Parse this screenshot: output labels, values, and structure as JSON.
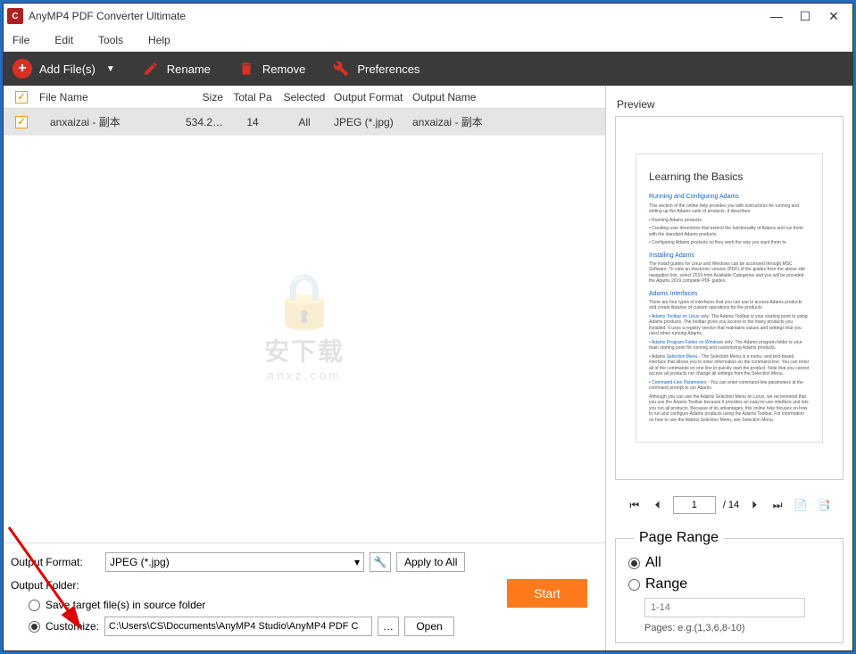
{
  "app": {
    "title": "AnyMP4 PDF Converter Ultimate"
  },
  "menubar": {
    "file": "File",
    "edit": "Edit",
    "tools": "Tools",
    "help": "Help"
  },
  "toolbar": {
    "add_files": "Add File(s)",
    "rename": "Rename",
    "remove": "Remove",
    "preferences": "Preferences"
  },
  "table": {
    "headers": {
      "file_name": "File Name",
      "size": "Size",
      "total_pa": "Total Pa",
      "selected": "Selected",
      "output_format": "Output Format",
      "output_name": "Output Name"
    },
    "rows": [
      {
        "checked": true,
        "file_name": "anxaizai - 副本",
        "size": "534.2…",
        "total_pages": "14",
        "selected": "All",
        "output_format": "JPEG (*.jpg)",
        "output_name": "anxaizai - 副本"
      }
    ]
  },
  "watermark": {
    "text": "安下载",
    "url": "anxz.com"
  },
  "bottom": {
    "output_format_label": "Output Format:",
    "format_value": "JPEG (*.jpg)",
    "apply_all": "Apply to All",
    "output_folder_label": "Output Folder:",
    "save_source": "Save target file(s) in source folder",
    "customize": "Customize:",
    "path": "C:\\Users\\CS\\Documents\\AnyMP4 Studio\\AnyMP4 PDF C",
    "browse": "…",
    "open": "Open",
    "start": "Start"
  },
  "preview": {
    "label": "Preview",
    "doc_title": "Learning the Basics",
    "h_running": "Running and Configuring Adams",
    "p1": "This section of the online help provides you with instructions for running and setting up the Adams suite of products. It describes:",
    "b1": "Running Adams products",
    "b2": "Creating user directories that extend the functionality of Adams and run them with the standard Adams products.",
    "b3": "Configuring Adams products so they work the way you want them to.",
    "h_install": "Installing Adams",
    "p2": "The install guides for Linux and Windows can be accessed through MSC Software. To view an electronic version (PDF) of the guides from the above site navigation link, select 2019 from Available Categories and you will be provided the Adams 2019 complete PDF guides.",
    "h_interfaces": "Adams Interfaces",
    "p3": "There are four types of interfaces that you can use to access Adams products and create libraries of custom operations for the products:",
    "li1": "only: The Adams Toolbar is your starting point to using Adams products. The toolbar gives you access to the many products you installed. It uses a registry service that maintains values and settings that you used when running Adams.",
    "li2": "only: The Adams program folder is your main starting point for running and customizing Adams products.",
    "li3": "The Selection Menu is a menu- and text-based interface that allows you to enter information on the command line. You can enter all of the commands on one line to quickly start the product. Note that you cannot access all products nor change all settings from the Selection Menu.",
    "li4": "You can enter command-line parameters at the command prompt to run Adams.",
    "p4": "Although you can use the Adams Selection Menu on Linux, we recommend that you use the Adams Toolbar because it provides an easy-to-use interface and lets you run all products. Because of its advantages, this online help focuses on how to run and configure Adams products using the Adams Toolbar. For information on how to use the Adams Selection Menu, see Selection Menu.",
    "current_page": "1",
    "total_pages": "/ 14"
  },
  "page_range": {
    "legend": "Page Range",
    "all": "All",
    "range": "Range",
    "placeholder": "1-14",
    "hint": "Pages: e.g.(1,3,6,8-10)"
  }
}
